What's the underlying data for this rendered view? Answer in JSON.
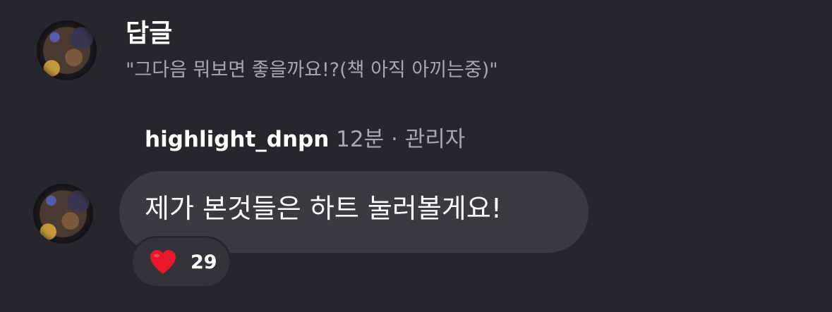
{
  "reply": {
    "label": "답글",
    "quoted_text": "\"그다음 뭐보면 좋을까요!?(책 아직 아끼는중)\""
  },
  "comment": {
    "username": "highlight_dnpn",
    "time": "12분",
    "separator": "·",
    "role": "관리자",
    "text": "제가 본것들은 하트 눌러볼게요!"
  },
  "reaction": {
    "icon": "heart-icon",
    "color": "#e8172b",
    "count": "29"
  }
}
